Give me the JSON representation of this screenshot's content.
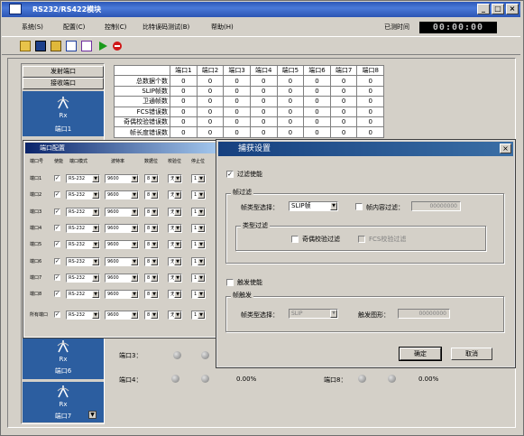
{
  "window": {
    "title": "RS232/RS422模块",
    "buttons": [
      "_",
      "□",
      "×"
    ]
  },
  "menu": {
    "items": [
      "系统(S)",
      "配置(C)",
      "控制(C)",
      "比特误码测试(B)",
      "帮助(H)"
    ],
    "elapsed_label": "已测时间",
    "elapsed_value": "00:00:00"
  },
  "toolbar": {
    "icons": [
      "open-icon",
      "save-icon",
      "save-as-icon",
      "config-icon",
      "config2-icon",
      "start-icon",
      "stop-icon"
    ]
  },
  "left": {
    "send_label": "发射端口",
    "recv_label": "接收端口",
    "rx": "Rx",
    "port1": "端口1",
    "port6": "端口6",
    "port7": "端口7"
  },
  "stats": {
    "columns": [
      "端口1",
      "端口2",
      "端口3",
      "端口4",
      "端口5",
      "端口6",
      "端口7",
      "端口8"
    ],
    "rows": [
      {
        "label": "总数据个数",
        "values": [
          "0",
          "0",
          "0",
          "0",
          "0",
          "0",
          "0",
          "0"
        ]
      },
      {
        "label": "SLIP帧数",
        "values": [
          "0",
          "0",
          "0",
          "0",
          "0",
          "0",
          "0",
          "0"
        ]
      },
      {
        "label": "卫通帧数",
        "values": [
          "0",
          "0",
          "0",
          "0",
          "0",
          "0",
          "0",
          "0"
        ]
      },
      {
        "label": "FCS错误数",
        "values": [
          "0",
          "0",
          "0",
          "0",
          "0",
          "0",
          "0",
          "0"
        ]
      },
      {
        "label": "奇偶校验错误数",
        "values": [
          "0",
          "0",
          "0",
          "0",
          "0",
          "0",
          "0",
          "0"
        ]
      },
      {
        "label": "帧长度错误数",
        "values": [
          "0",
          "0",
          "0",
          "0",
          "0",
          "0",
          "0",
          "0"
        ]
      }
    ]
  },
  "port_config": {
    "title": "端口配置",
    "headers": [
      "端口号",
      "使能",
      "端口模式",
      "波特率",
      "数据位",
      "校验位",
      "停止位"
    ],
    "rows": [
      {
        "port": "端口1",
        "mode": "RS-232",
        "baud": "9600",
        "data": "8",
        "parity": "无",
        "stop": "1"
      },
      {
        "port": "端口2",
        "mode": "RS-232",
        "baud": "9600",
        "data": "8",
        "parity": "无",
        "stop": "1"
      },
      {
        "port": "端口3",
        "mode": "RS-232",
        "baud": "9600",
        "data": "8",
        "parity": "无",
        "stop": "1"
      },
      {
        "port": "端口4",
        "mode": "RS-232",
        "baud": "9600",
        "data": "8",
        "parity": "无",
        "stop": "1"
      },
      {
        "port": "端口5",
        "mode": "RS-232",
        "baud": "9600",
        "data": "8",
        "parity": "无",
        "stop": "1"
      },
      {
        "port": "端口6",
        "mode": "RS-232",
        "baud": "9600",
        "data": "8",
        "parity": "无",
        "stop": "1"
      },
      {
        "port": "端口7",
        "mode": "RS-232",
        "baud": "9600",
        "data": "8",
        "parity": "无",
        "stop": "1"
      },
      {
        "port": "端口8",
        "mode": "RS-232",
        "baud": "9600",
        "data": "8",
        "parity": "无",
        "stop": "1"
      }
    ],
    "all": {
      "port": "所有端口",
      "mode": "RS-232",
      "baud": "9600",
      "data": "8",
      "parity": "无",
      "stop": "1"
    }
  },
  "capture": {
    "title": "捕获设置",
    "filter_enable": "过滤使能",
    "frame_filter": "帧过滤",
    "frame_type_label": "帧类型选择：",
    "frame_type_value": "SLIP帧",
    "content_filter_label": "帧内容过滤：",
    "content_filter_value": "00000000",
    "type_filter": "类型过滤",
    "parity_filter": "奇偶校验过滤",
    "fcs_filter": "FCS校验过滤",
    "trigger_enable": "触发使能",
    "frame_trigger": "帧触发",
    "trig_type_label": "帧类型选择：",
    "trig_type_value": "SLIP",
    "trig_pattern_label": "触发图形：",
    "trig_pattern_value": "00000000",
    "ok": "确定",
    "cancel": "取消"
  },
  "bottom": {
    "port3": "端口3：",
    "port4": "端口4：",
    "port8": "端口8：",
    "pct4": "0.00%",
    "pct8": "0.00%"
  }
}
